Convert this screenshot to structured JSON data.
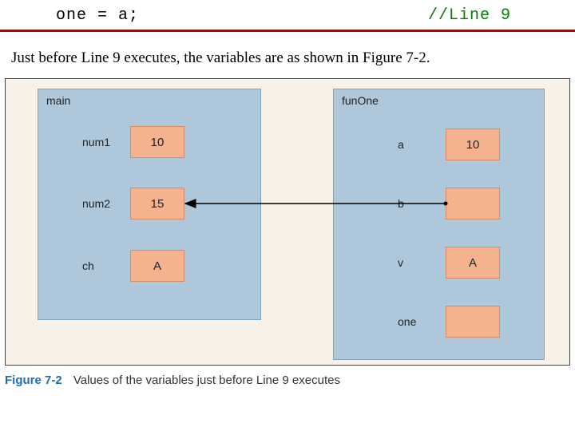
{
  "code": {
    "statement": "one = a;",
    "comment": "//Line 9"
  },
  "explanation": "Just before Line 9 executes, the variables are as shown in Figure 7-2.",
  "figure": {
    "scopes": {
      "main": {
        "title": "main",
        "vars": {
          "num1": {
            "label": "num1",
            "value": "10"
          },
          "num2": {
            "label": "num2",
            "value": "15"
          },
          "ch": {
            "label": "ch",
            "value": "A"
          }
        }
      },
      "funOne": {
        "title": "funOne",
        "vars": {
          "a": {
            "label": "a",
            "value": "10"
          },
          "b": {
            "label": "b",
            "value": ""
          },
          "v": {
            "label": "v",
            "value": "A"
          },
          "one": {
            "label": "one",
            "value": ""
          }
        }
      }
    }
  },
  "caption": {
    "number": "Figure 7-2",
    "text": "Values of the variables just before Line 9 executes"
  }
}
